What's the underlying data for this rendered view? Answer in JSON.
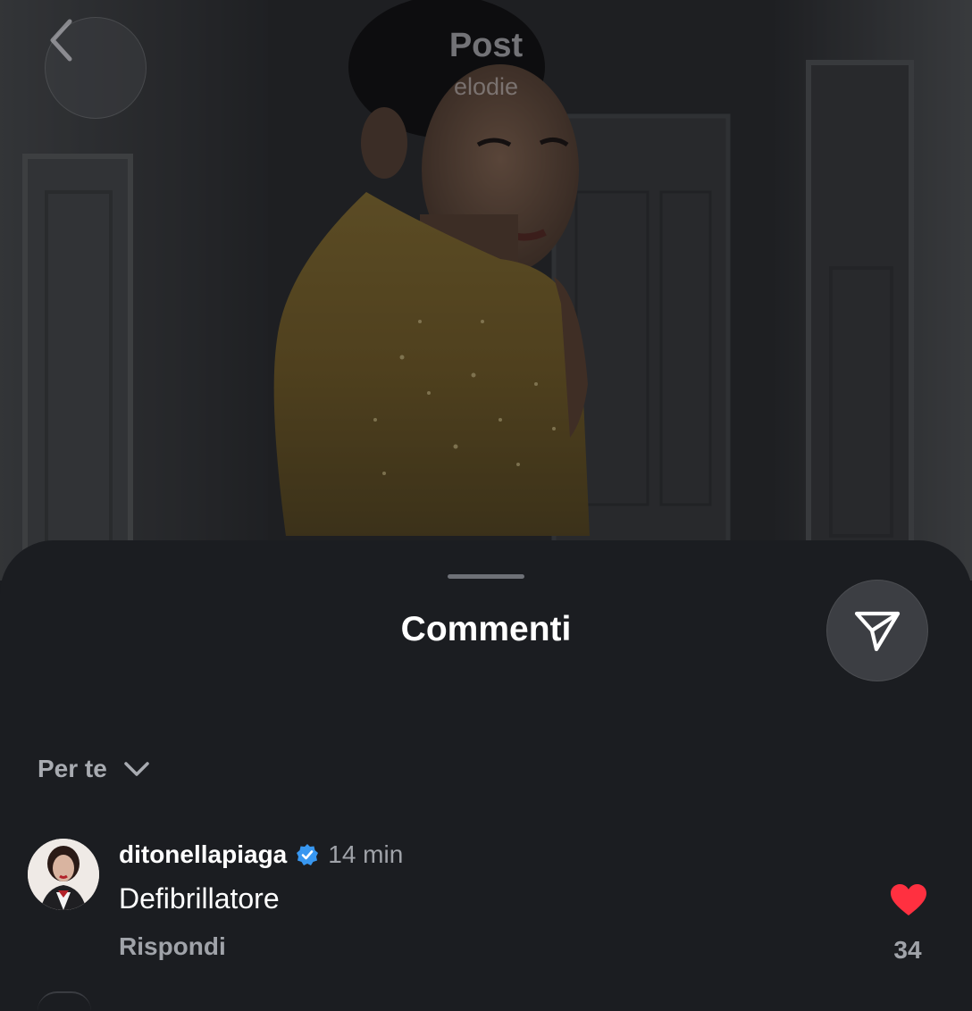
{
  "header": {
    "title": "Post",
    "subtitle": "elodie"
  },
  "sheet": {
    "title": "Commenti",
    "sort_label": "Per te"
  },
  "comments": [
    {
      "username": "ditonellapiaga",
      "verified": true,
      "time": "14 min",
      "text": "Defibrillatore",
      "reply_label": "Rispondi",
      "likes": "34",
      "liked": true
    }
  ],
  "icons": {
    "back": "chevron-left-icon",
    "share": "send-icon",
    "sort": "chevron-down-icon",
    "verified": "verified-badge-icon",
    "like": "heart-icon"
  },
  "colors": {
    "sheet_bg": "#1b1d21",
    "verified": "#3897f0",
    "like": "#ff3040",
    "muted_text": "#a0a3a9"
  }
}
